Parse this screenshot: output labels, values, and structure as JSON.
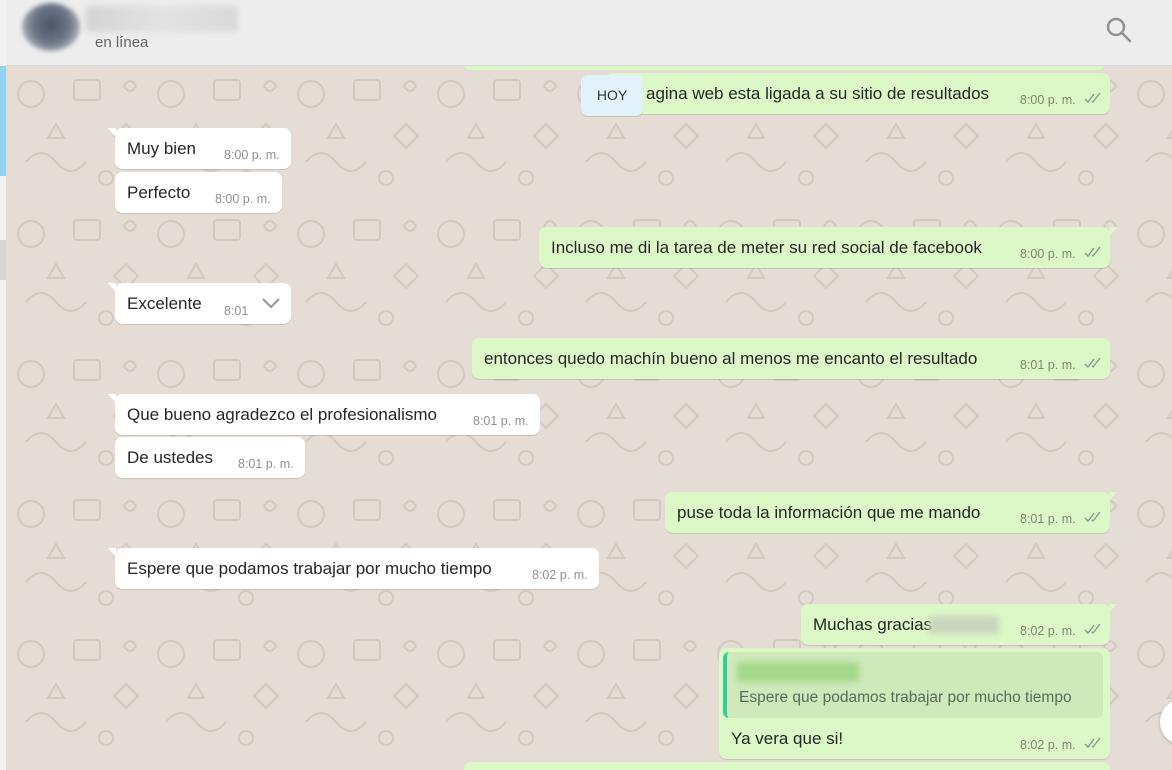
{
  "header": {
    "status": "en línea",
    "search_icon": "search-icon"
  },
  "date_divider": "HOY",
  "messages": [
    {
      "dir": "out",
      "text": "agina web esta ligada a su sitio de resultados",
      "time": "8:00 p. m."
    },
    {
      "dir": "in",
      "text": "Muy bien",
      "time": "8:00 p. m."
    },
    {
      "dir": "in",
      "text": "Perfecto",
      "time": "8:00 p. m."
    },
    {
      "dir": "out",
      "text": "Incluso me di la tarea de meter su red social de facebook",
      "time": "8:00 p. m."
    },
    {
      "dir": "in",
      "text": "Excelente",
      "time": "8:01"
    },
    {
      "dir": "out",
      "text": "entonces quedo machín bueno al menos me encanto el resultado",
      "time": "8:01 p. m."
    },
    {
      "dir": "in",
      "text": "Que bueno agradezco el profesionalismo",
      "time": "8:01 p. m."
    },
    {
      "dir": "in",
      "text": "De ustedes",
      "time": "8:01 p. m."
    },
    {
      "dir": "out",
      "text": "puse toda la información que me mando",
      "time": "8:01 p. m."
    },
    {
      "dir": "in",
      "text": "Espere que podamos trabajar por mucho tiempo",
      "time": "8:02 p. m."
    },
    {
      "dir": "out",
      "text": "Muchas gracias",
      "time": "8:02 p. m."
    },
    {
      "dir": "out",
      "text": "Ya vera que si!",
      "time": "8:02 p. m.",
      "quoted_text": "Espere que podamos trabajar por mucho tiempo"
    }
  ],
  "colors": {
    "chat_background": "#e5ddd5",
    "incoming_bubble": "#ffffff",
    "outgoing_bubble": "#dcf8c6",
    "read_ticks": "#8a9a90",
    "quote_bar": "#35cd96",
    "date_chip": "#e1f2fa"
  }
}
